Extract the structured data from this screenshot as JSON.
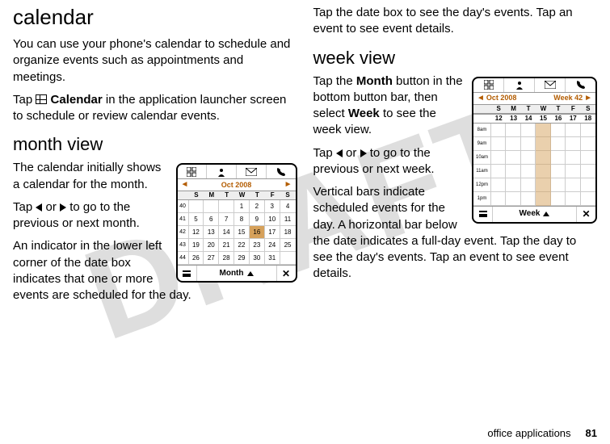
{
  "left": {
    "h1": "calendar",
    "p1a": "You can use your phone's calendar to schedule and organize events such as appointments and meetings.",
    "p2_pre": "Tap ",
    "p2_bold": "Calendar",
    "p2_post": " in the application launcher screen to schedule or review calendar events.",
    "h2": "month view",
    "p3": "The calendar initially shows a calendar for the month.",
    "p4_pre": "Tap ",
    "p4_mid": " or ",
    "p4_post": " to go to the previous or next month.",
    "p5": "An indicator in the lower left corner of the date box indicates that one or more events are scheduled for the day."
  },
  "right": {
    "p1": "Tap the date box to see the day's events. Tap an event to see event details.",
    "h2": "week view",
    "p2_pre": "Tap the ",
    "p2_bold1": "Month",
    "p2_mid": " button in the bottom button bar, then select ",
    "p2_bold2": "Week",
    "p2_post": " to see the week view.",
    "p3_pre": "Tap ",
    "p3_mid": " or ",
    "p3_post": " to go to the previous or next week.",
    "p4": "Vertical bars indicate scheduled events for the day. A horizontal bar below the date indicates a full-day event. Tap the day to see the day's events. Tap an event to see event details."
  },
  "month_phone": {
    "title": "Oct  2008",
    "dow": [
      "S",
      "M",
      "T",
      "W",
      "T",
      "F",
      "S"
    ],
    "weeks": [
      "40",
      "41",
      "42",
      "43",
      "44"
    ],
    "days": [
      "",
      "",
      "",
      "1",
      "2",
      "3",
      "4",
      "5",
      "6",
      "7",
      "8",
      "9",
      "10",
      "11",
      "12",
      "13",
      "14",
      "15",
      "16",
      "17",
      "18",
      "19",
      "20",
      "21",
      "22",
      "23",
      "24",
      "25",
      "26",
      "27",
      "28",
      "29",
      "30",
      "31",
      ""
    ],
    "highlight_index": 18,
    "bottom_label": "Month"
  },
  "week_phone": {
    "title_left": "Oct 2008",
    "title_right": "Week 42",
    "dow": [
      "S",
      "M",
      "T",
      "W",
      "T",
      "F",
      "S"
    ],
    "dates": [
      "12",
      "13",
      "14",
      "15",
      "16",
      "17",
      "18"
    ],
    "times": [
      "8am",
      "9am",
      "10am",
      "11am",
      "12pm",
      "1pm"
    ],
    "bottom_label": "Week"
  },
  "footer": {
    "label": "office applications",
    "page": "81"
  },
  "watermark": "DRAFT"
}
